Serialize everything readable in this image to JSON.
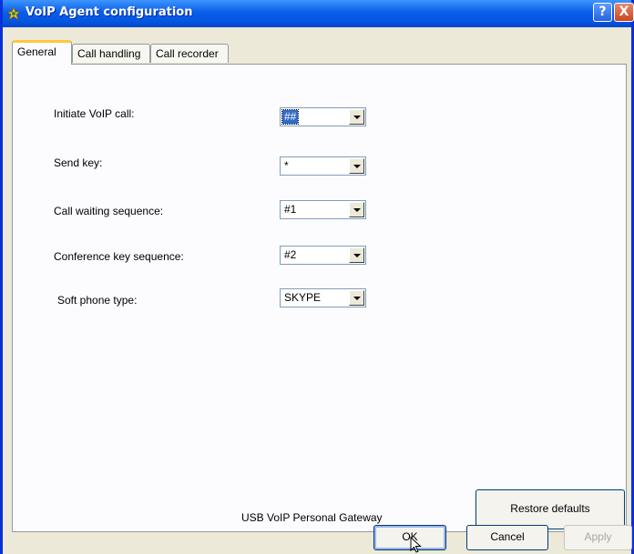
{
  "window": {
    "title": "VoIP Agent configuration",
    "help_label": "?",
    "close_label": "X"
  },
  "tabs": [
    {
      "label": "General",
      "active": true
    },
    {
      "label": "Call handling",
      "active": false
    },
    {
      "label": "Call recorder",
      "active": false
    }
  ],
  "fields": {
    "initiate_call": {
      "label": "Initiate VoIP call:",
      "value": "##"
    },
    "send_key": {
      "label": "Send key:",
      "value": "*"
    },
    "call_waiting": {
      "label": "Call waiting sequence:",
      "value": "#1"
    },
    "conference_key": {
      "label": "Conference key sequence:",
      "value": "#2"
    },
    "soft_phone": {
      "label": "Soft phone type:",
      "value": "SKYPE"
    }
  },
  "footer": {
    "product_name": "USB VoIP Personal Gateway",
    "restore_label": "Restore defaults"
  },
  "buttons": {
    "ok": "OK",
    "cancel": "Cancel",
    "apply": "Apply"
  }
}
